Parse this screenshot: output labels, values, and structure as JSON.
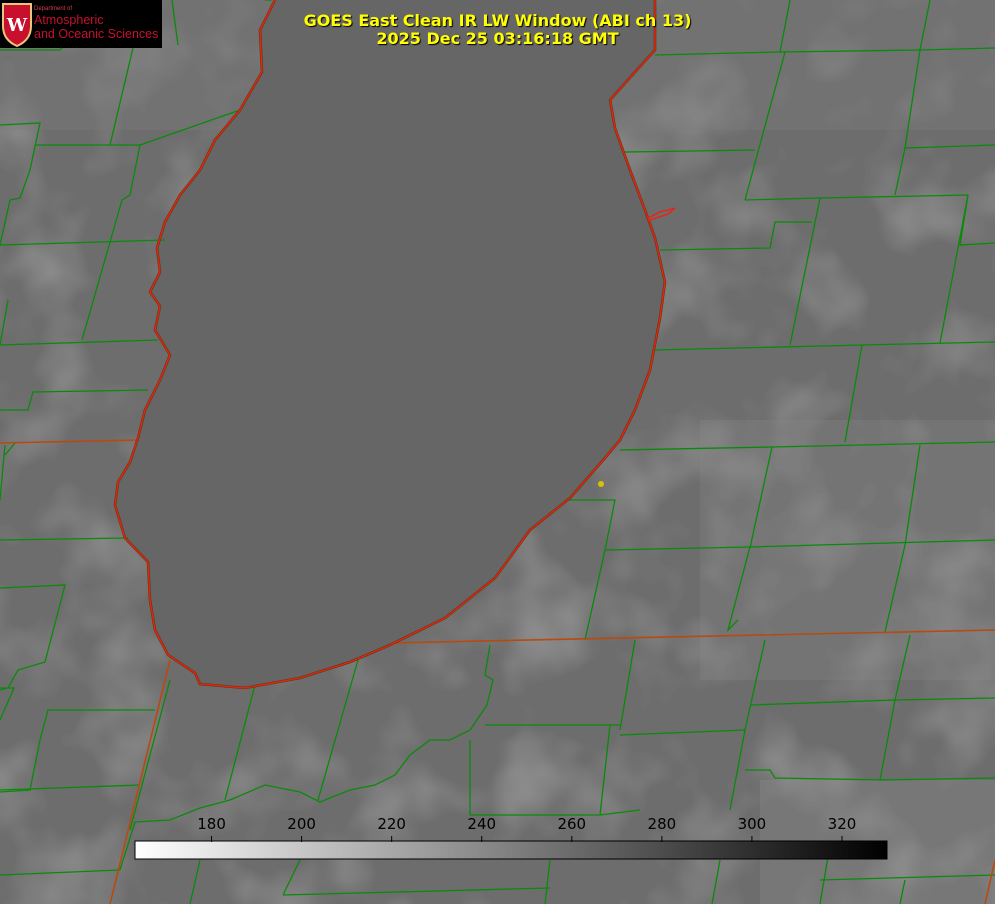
{
  "header": {
    "title_line1": "GOES East Clean IR LW Window (ABI ch 13)",
    "title_line2": "2025 Dec 25 03:16:18 GMT"
  },
  "logo": {
    "dept": "Department of",
    "line1": "Atmospheric",
    "line2": "and Oceanic Sciences",
    "crest_letter": "W"
  },
  "colorbar": {
    "ticks": [
      "180",
      "200",
      "220",
      "240",
      "260",
      "280",
      "300",
      "320"
    ],
    "tick_values": [
      180,
      200,
      220,
      240,
      260,
      280,
      300,
      320
    ],
    "range": [
      163,
      330
    ],
    "gradient": [
      "#ffffff",
      "#000000"
    ]
  },
  "colors": {
    "county_lines": "#0a8a0a",
    "lake_outline": "#ee2010",
    "state_border": "#b84a10",
    "marker": "#d6c300"
  }
}
